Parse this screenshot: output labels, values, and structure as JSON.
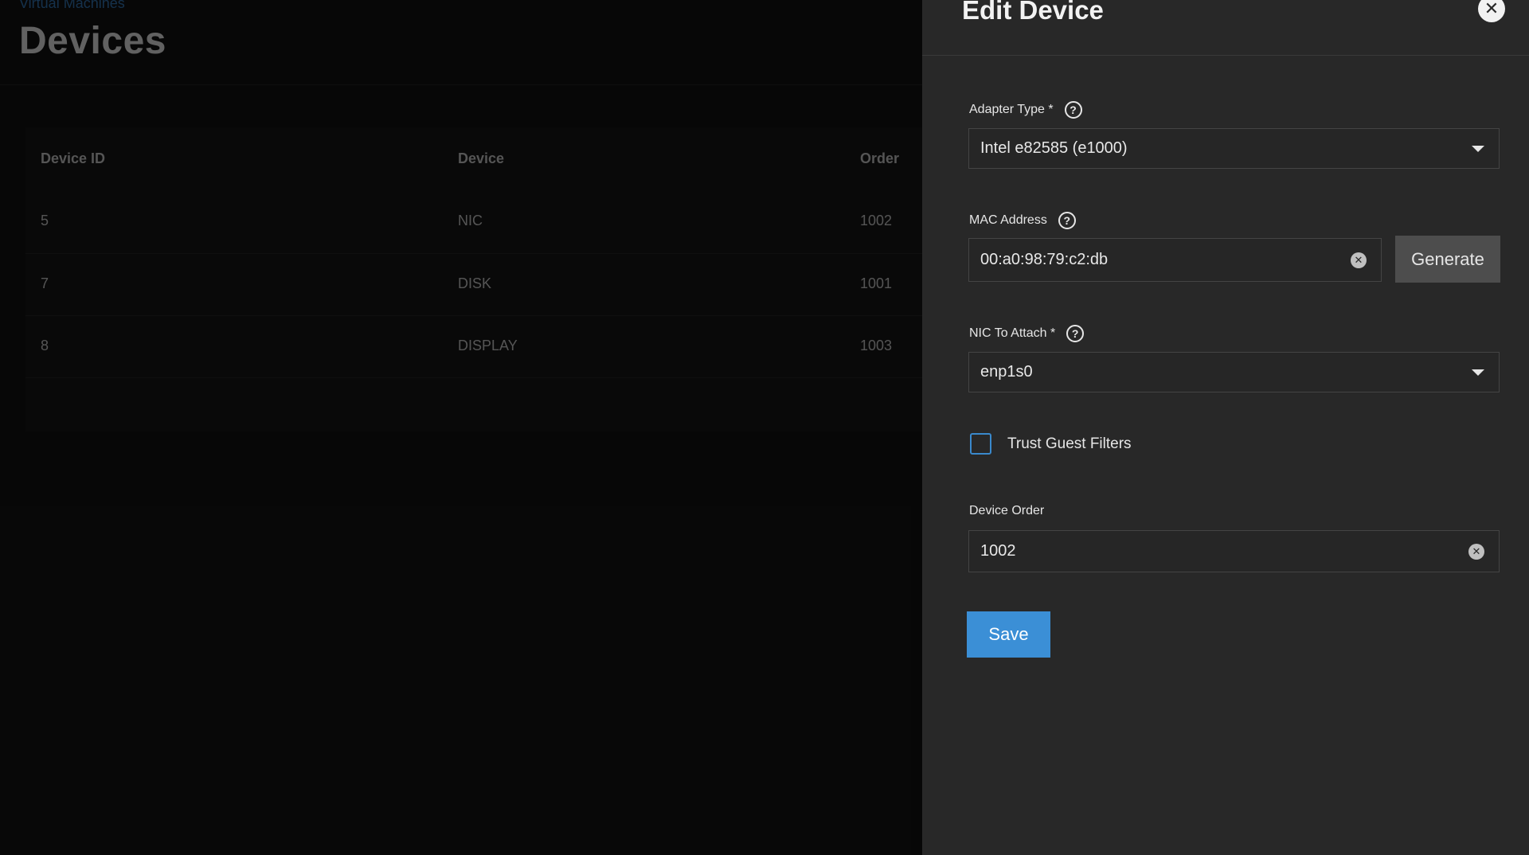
{
  "background": {
    "breadcrumb": "Virtual Machines",
    "title": "Devices",
    "table": {
      "headers": [
        "Device ID",
        "Device",
        "Order"
      ],
      "rows": [
        [
          "5",
          "NIC",
          "1002"
        ],
        [
          "7",
          "DISK",
          "1001"
        ],
        [
          "8",
          "DISPLAY",
          "1003"
        ]
      ]
    }
  },
  "panel": {
    "title": "Edit Device",
    "close_icon": "close-icon",
    "adapter_type": {
      "label": "Adapter Type *",
      "value": "Intel e82585 (e1000)"
    },
    "mac_address": {
      "label": "MAC Address",
      "value": "00:a0:98:79:c2:db",
      "generate_label": "Generate"
    },
    "nic_to_attach": {
      "label": "NIC To Attach *",
      "value": "enp1s0"
    },
    "trust_guest_filters": {
      "label": "Trust Guest Filters",
      "checked": false
    },
    "device_order": {
      "label": "Device Order",
      "value": "1002"
    },
    "save_label": "Save"
  },
  "colors": {
    "accent": "#3b8fd6",
    "panel_bg": "#282828",
    "page_bg": "#0a0a0a",
    "checkbox_border": "#3a89cc"
  }
}
